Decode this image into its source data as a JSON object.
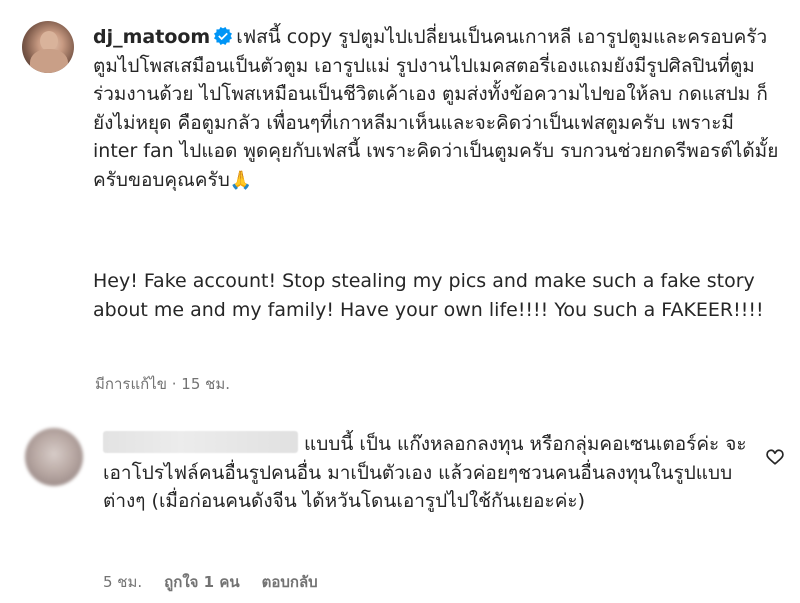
{
  "main_comment": {
    "username": "dj_matoom",
    "verified": true,
    "text": "เฟสนี้ copy รูปตูมไปเปลี่ยนเป็นคนเกาหลี เอารูปตูมและครอบครัวตูมไปโพสเสมือนเป็นตัวตูม เอารูปแม่ รูปงานไปเมคสตอรี่เองแถมยังมีรูปศิลปินที่ตูมร่วมงานด้วย ไปโพสเหมือนเป็นชีวิตเค้าเอง ตูมส่งทั้งข้อความไปขอให้ลบ กดแสปม ก็ยังไม่หยุด คือตูมกลัว เพื่อนๆที่เกาหลีมาเห็นและจะคิดว่าเป็นเฟสตูมครับ เพราะมี inter fan ไปแอด พูดคุยกับเฟสนี้ เพราะคิดว่าเป็นตูมครับ รบกวนช่วยกดรีพอรต์ได้มั้ยครับขอบคุณครับ",
    "emoji": "🙏",
    "english_text": "Hey! Fake account! Stop stealing my pics and make such a fake story about me and my family! Have your own life!!!! You such a FAKEER!!!!",
    "meta": "มีการแก้ไข · 15 ชม."
  },
  "reply_comment": {
    "text": "แบบนี้ เป็น แก๊งหลอกลงทุน หรือกลุ่มคอเซนเตอร์ค่ะ จะเอาโปรไฟล์คนอื่นรูปคนอื่น มาเป็นตัวเอง แล้วค่อยๆชวนคนอื่นลงทุนในรูปแบบต่างๆ (เมื่อก่อนคนดังจีน ได้หวันโดนเอารูปไปใช้กันเยอะค่ะ)",
    "time": "5 ชม.",
    "likes": "ถูกใจ 1 คน",
    "reply_label": "ตอบกลับ"
  },
  "icons": {
    "verified": "verified-badge-icon",
    "like": "heart-outline-icon"
  },
  "colors": {
    "text": "#262626",
    "secondary": "#737373",
    "verified_blue": "#0095f6"
  }
}
